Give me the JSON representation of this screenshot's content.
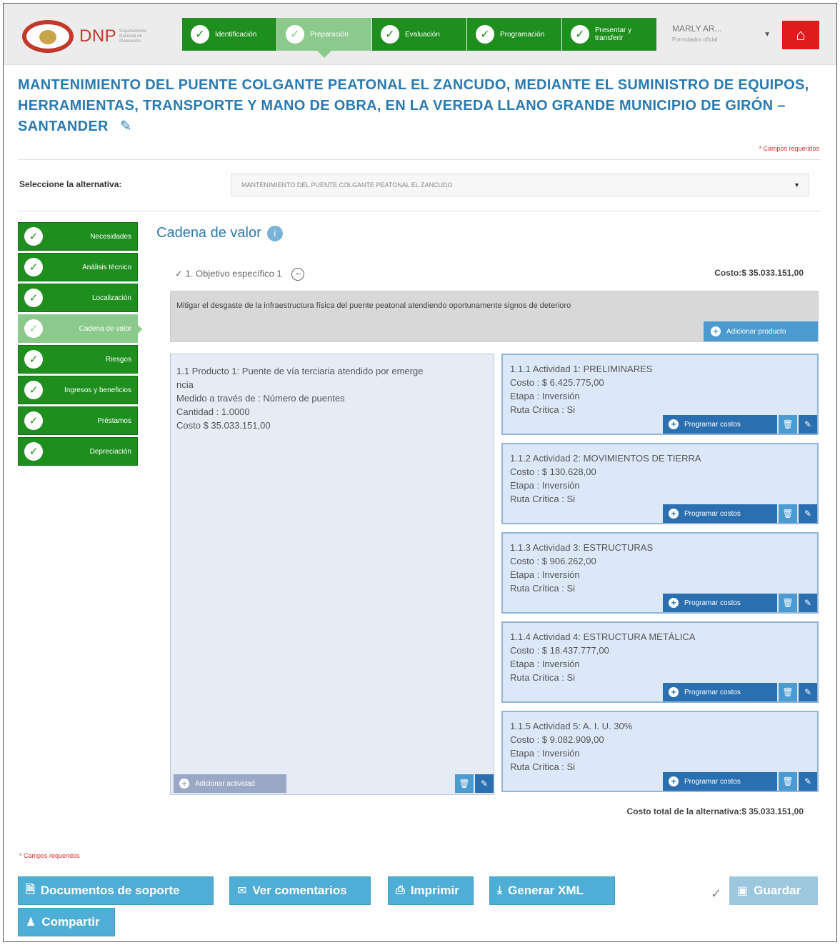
{
  "header": {
    "logo_text": "DNP",
    "logo_sub": "Departamento Nacional de Planeación",
    "steps": [
      {
        "label": "Identificación",
        "active": false
      },
      {
        "label": "Preparación",
        "active": true
      },
      {
        "label": "Evaluación",
        "active": false
      },
      {
        "label": "Programación",
        "active": false
      },
      {
        "label": "Presentar y transferir",
        "active": false
      }
    ],
    "user_name": "MARLY AR...",
    "user_role": "Formulador oficial"
  },
  "project": {
    "title": "MANTENIMIENTO DEL PUENTE COLGANTE PEATONAL EL ZANCUDO, MEDIANTE EL SUMINISTRO DE EQUIPOS, HERRAMIENTAS, TRANSPORTE Y MANO DE OBRA, EN LA VEREDA LLANO GRANDE MUNICIPIO DE GIRÓN – SANTANDER",
    "required_note": "* Campos requeridos"
  },
  "alternative": {
    "label": "Seleccione la alternativa:",
    "selected": "MANTENIMIENTO DEL PUENTE COLGANTE PEATONAL EL ZANCUDO"
  },
  "sidenav": [
    {
      "label": "Necesidades",
      "active": false
    },
    {
      "label": "Análisis técnico",
      "active": false
    },
    {
      "label": "Localización",
      "active": false
    },
    {
      "label": "Cadena de valor",
      "active": true
    },
    {
      "label": "Riesgos",
      "active": false
    },
    {
      "label": "Ingresos y beneficios",
      "active": false
    },
    {
      "label": "Préstamos",
      "active": false
    },
    {
      "label": "Depreciación",
      "active": false
    }
  ],
  "cadena": {
    "title": "Cadena de valor",
    "objective_label": "1. Objetivo específico 1",
    "objective_cost": "Costo:$ 35.033.151,00",
    "objective_text": "Mitigar el desgaste de la infraestructura física del puente peatonal atendiendo oportunamente signos de deterioro",
    "add_product": "Adicionar producto",
    "product": {
      "line1": "1.1 Producto 1: Puente de vía terciaria atendido por emerge",
      "line2": "ncia",
      "line3": "Medido a través de : Número de puentes",
      "line4": "Cantidad : 1.0000",
      "line5": "Costo $ 35.033.151,00"
    },
    "add_activity": "Adicionar actividad",
    "program_costs": "Programar costos",
    "activities": [
      {
        "title": "1.1.1 Actividad 1: PRELIMINARES",
        "cost": "Costo : $ 6.425.775,00",
        "stage": "Etapa : Inversión",
        "critical": "Ruta Crítica : Si"
      },
      {
        "title": "1.1.2 Actividad 2: MOVIMIENTOS DE TIERRA",
        "cost": "Costo : $ 130.628,00",
        "stage": "Etapa : Inversión",
        "critical": "Ruta Crítica : Si"
      },
      {
        "title": "1.1.3 Actividad 3: ESTRUCTURAS",
        "cost": "Costo : $ 906.262,00",
        "stage": "Etapa : Inversión",
        "critical": "Ruta Crítica : Si"
      },
      {
        "title": "1.1.4 Actividad 4: ESTRUCTURA METÁLICA",
        "cost": "Costo : $ 18.437.777,00",
        "stage": "Etapa : Inversión",
        "critical": "Ruta Crítica : Si"
      },
      {
        "title": "1.1.5 Actividad 5: A. I. U. 30%",
        "cost": "Costo : $ 9.082.909,00",
        "stage": "Etapa : Inversión",
        "critical": "Ruta Crítica : Si"
      }
    ],
    "total": "Costo total de la alternativa:$ 35.033.151,00"
  },
  "footer": {
    "required_note": "* Campos requeridos",
    "buttons": {
      "docs": "Documentos de soporte",
      "comments": "Ver comentarios",
      "print": "Imprimir",
      "xml": "Generar XML",
      "save": "Guardar",
      "share": "Compartir"
    }
  },
  "colors": {
    "step_green": "#1e8e1e",
    "step_active": "#8cc98c",
    "title_blue": "#2a7ab0",
    "button_blue": "#4faed6",
    "home_red": "#e01b1b"
  }
}
